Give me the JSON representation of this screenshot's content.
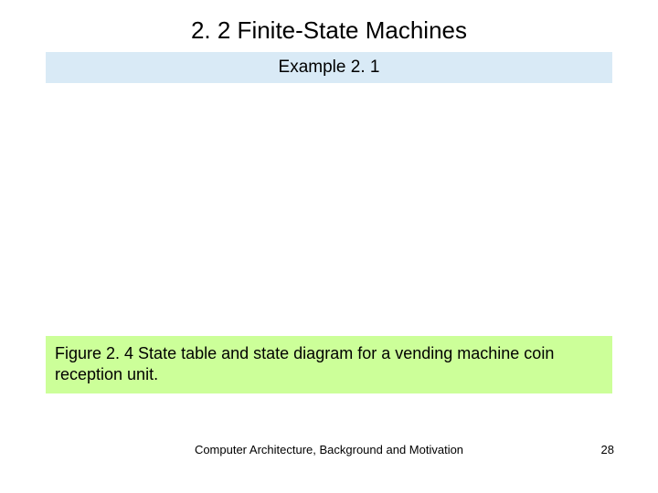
{
  "title": "2. 2  Finite-State Machines",
  "exampleLabel": "Example 2. 1",
  "caption": "Figure 2. 4    State table and state diagram for a vending machine coin reception unit.",
  "footer": "Computer Architecture, Background and Motivation",
  "pageNumber": "28"
}
